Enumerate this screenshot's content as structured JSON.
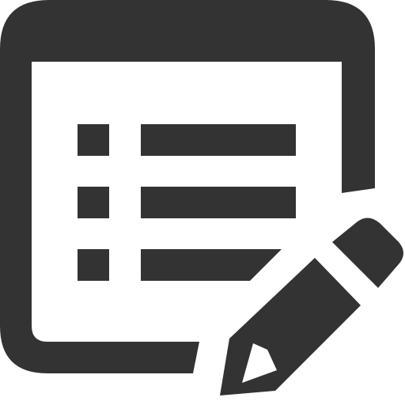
{
  "icon": {
    "name": "edit-list-icon",
    "parts": [
      "window-frame-icon",
      "list-bullets-icon",
      "list-lines-icon",
      "pencil-icon"
    ],
    "color": "#333333",
    "background": "#ffffff"
  }
}
